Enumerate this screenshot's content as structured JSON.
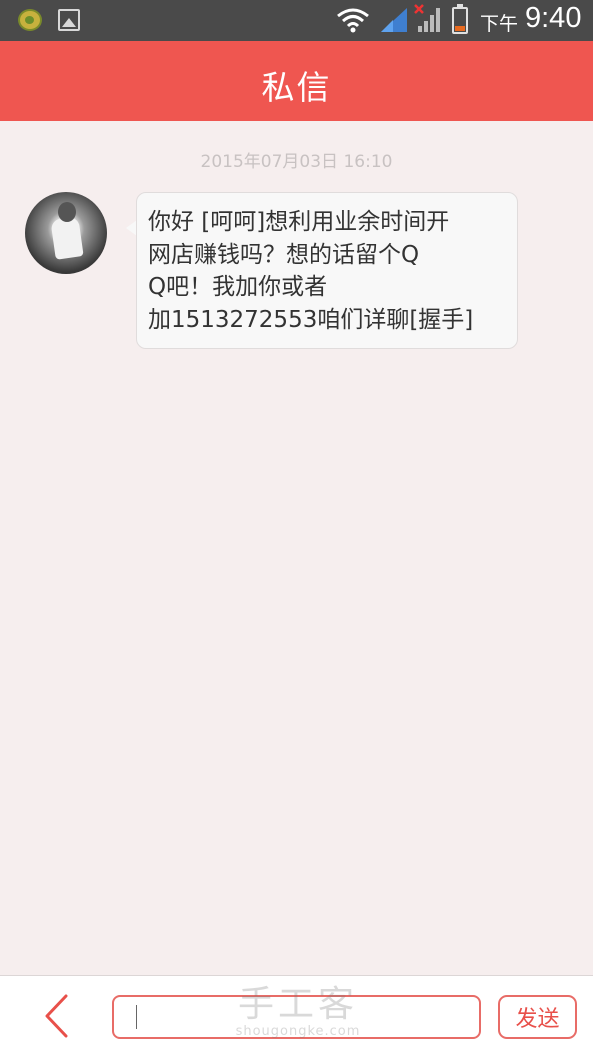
{
  "status_bar": {
    "time_label": "下午",
    "time": "9:40",
    "icons": [
      "app-notification-icon",
      "image-icon",
      "wifi-icon",
      "signal-icon",
      "signal-no-data-icon",
      "battery-icon"
    ],
    "battery_color": "#e86a1f"
  },
  "header": {
    "title": "私信",
    "background_color": "#ef5650"
  },
  "conversation": {
    "timestamp": "2015年07月03日 16:10",
    "message": {
      "sender_avatar": "avatar-image",
      "lines": [
        "你好 [呵呵]想利用业余时间开",
        "网店赚钱吗？想的话留个Q",
        "Q吧！我加你或者",
        "加1513272553咱们详聊[握手]"
      ]
    }
  },
  "composer": {
    "back_icon": "chevron-left-icon",
    "input_value": "",
    "send_label": "发送",
    "accent_color": "#e86c67"
  },
  "watermark": {
    "main": "手工客",
    "sub": "shougongke.com"
  }
}
